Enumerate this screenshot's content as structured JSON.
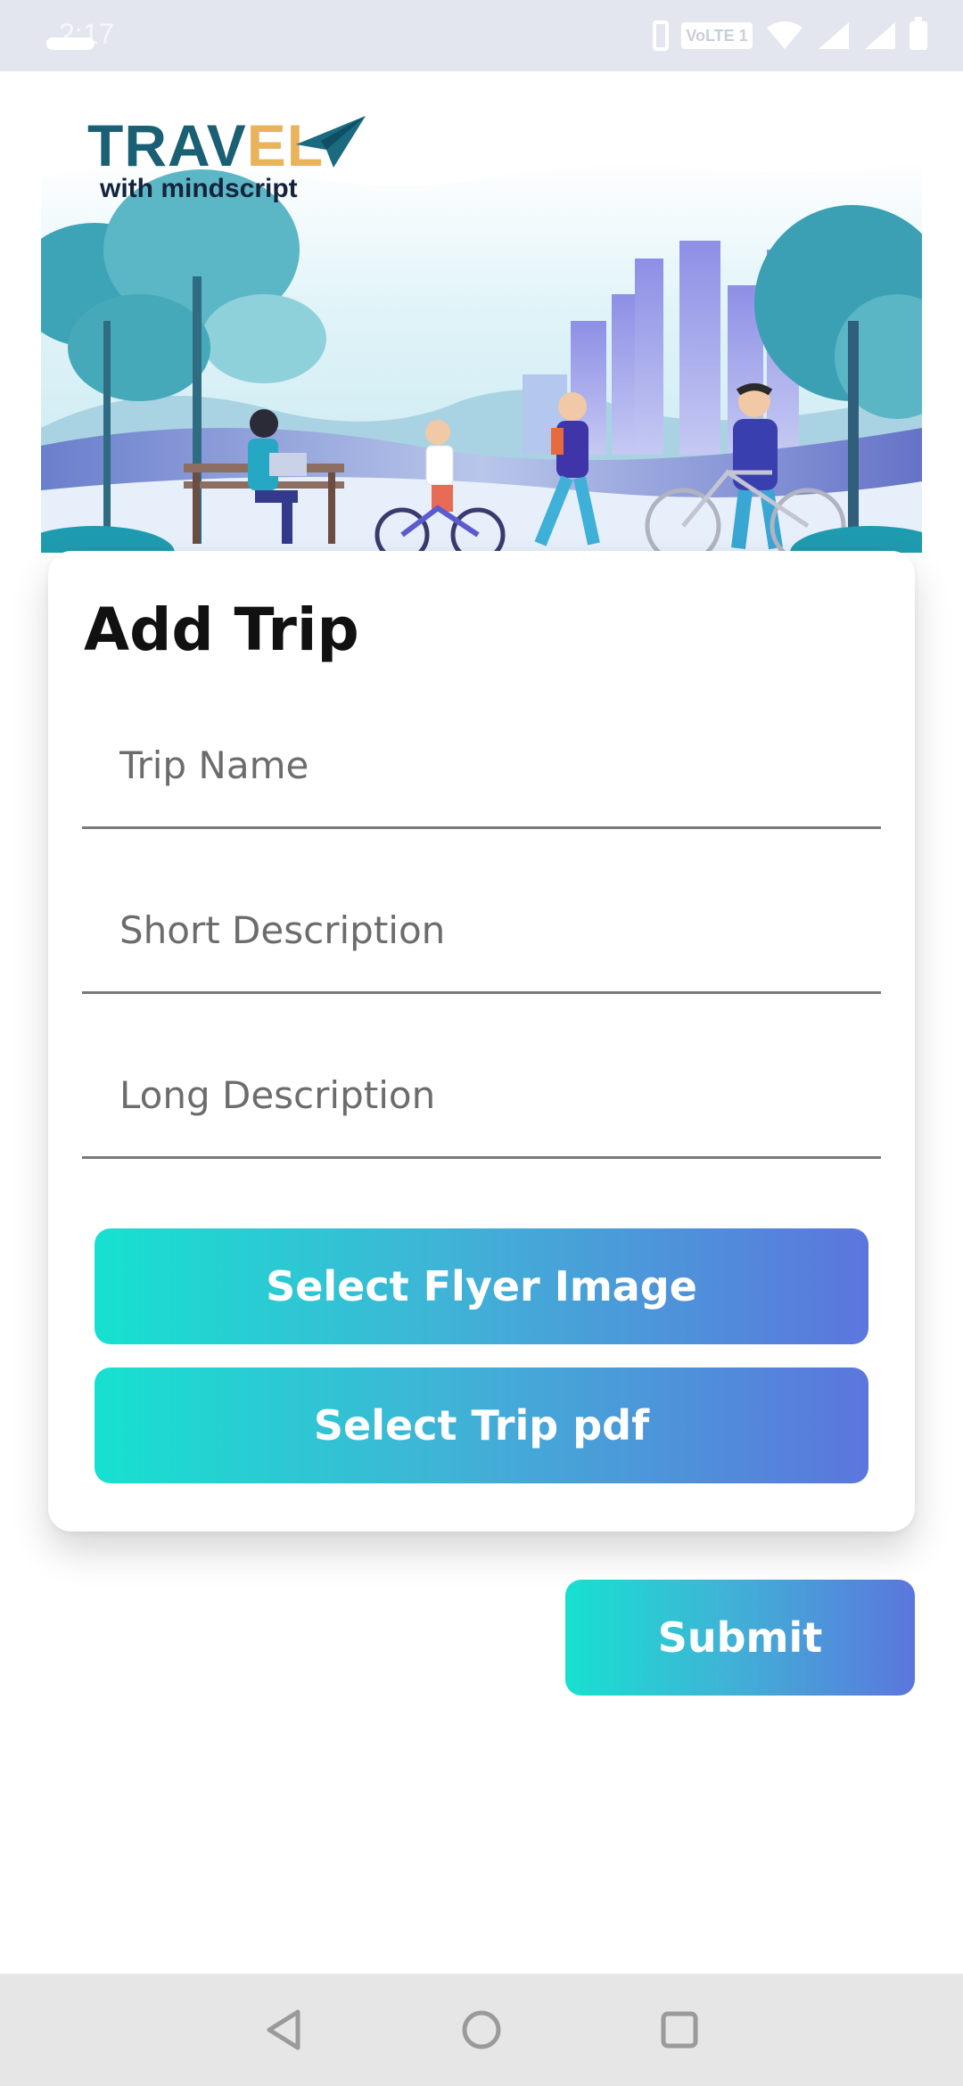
{
  "status_bar": {
    "time": "2:17",
    "network_badge": "VoLTE 1",
    "icons": [
      "phone-icon",
      "volte-icon",
      "wifi-icon",
      "signal-icon",
      "signal-icon",
      "battery-icon"
    ]
  },
  "banner": {
    "logo_main_left": "TRAV",
    "logo_main_accent": "EL",
    "logo_sub": "with mindscript",
    "logo_icon": "paper-plane-icon"
  },
  "form": {
    "title": "Add Trip",
    "trip_name_placeholder": "Trip Name",
    "short_description_placeholder": "Short Description",
    "long_description_placeholder": "Long Description",
    "select_flyer_label": "Select Flyer Image",
    "select_pdf_label": "Select Trip pdf"
  },
  "submit_label": "Submit",
  "nav": {
    "back": "back-icon",
    "home": "home-icon",
    "recents": "recents-icon"
  },
  "colors": {
    "gradient_start": "#16e1d0",
    "gradient_end": "#5b76dd",
    "logo_teal": "#1a5f73",
    "logo_accent": "#e8b35a"
  }
}
